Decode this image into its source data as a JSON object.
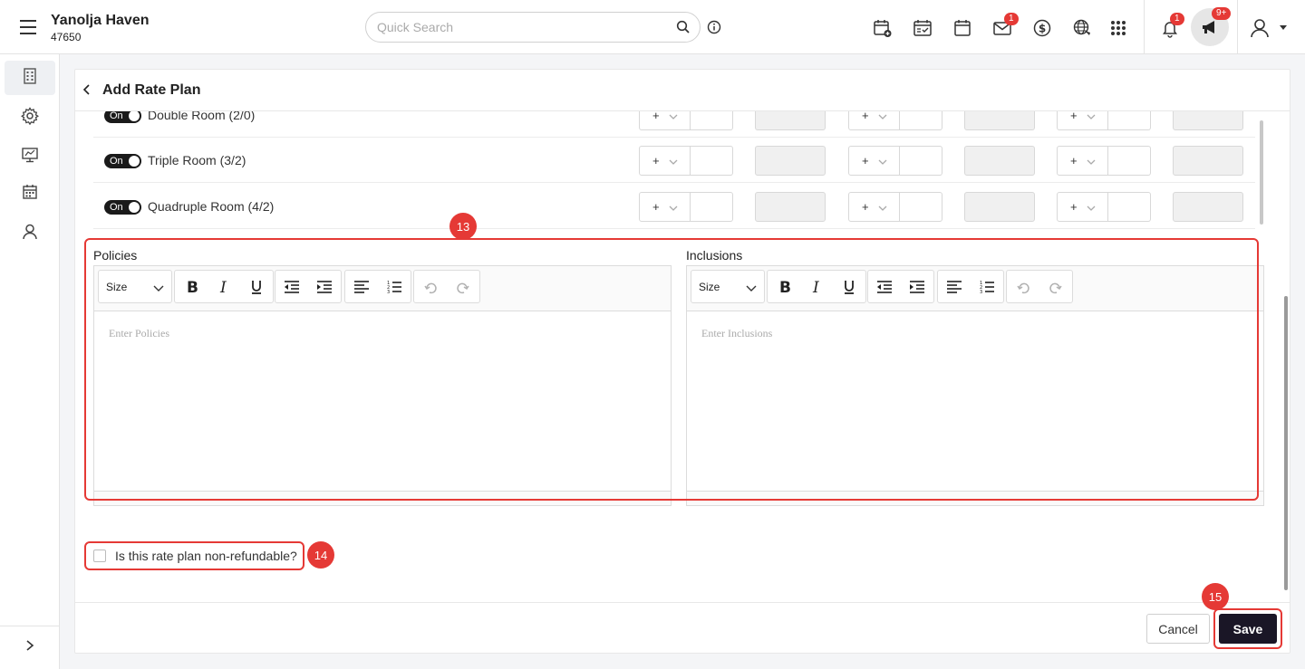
{
  "header": {
    "property_name": "Yanolja Haven",
    "property_id": "47650",
    "search_placeholder": "Quick Search",
    "mail_badge": "1",
    "notification_badge": "1",
    "announcement_badge": "9+"
  },
  "page": {
    "title": "Add Rate Plan"
  },
  "rooms": [
    {
      "toggle": "On",
      "name": "Double Room (2/0)",
      "adjust_1": "+",
      "adjust_2": "+",
      "adjust_3": "+"
    },
    {
      "toggle": "On",
      "name": "Triple Room (3/2)",
      "adjust_1": "+",
      "adjust_2": "+",
      "adjust_3": "+"
    },
    {
      "toggle": "On",
      "name": "Quadruple Room (4/2)",
      "adjust_1": "+",
      "adjust_2": "+",
      "adjust_3": "+"
    }
  ],
  "policies": {
    "label": "Policies",
    "size_label": "Size",
    "placeholder": "Enter Policies"
  },
  "inclusions": {
    "label": "Inclusions",
    "size_label": "Size",
    "placeholder": "Enter Inclusions"
  },
  "non_refundable": {
    "label": "Is this rate plan non-refundable?",
    "checked": false
  },
  "footer": {
    "cancel_label": "Cancel",
    "save_label": "Save"
  },
  "annotations": {
    "editors_step": "13",
    "refundable_step": "14",
    "save_step": "15",
    "color": "#e53935"
  }
}
